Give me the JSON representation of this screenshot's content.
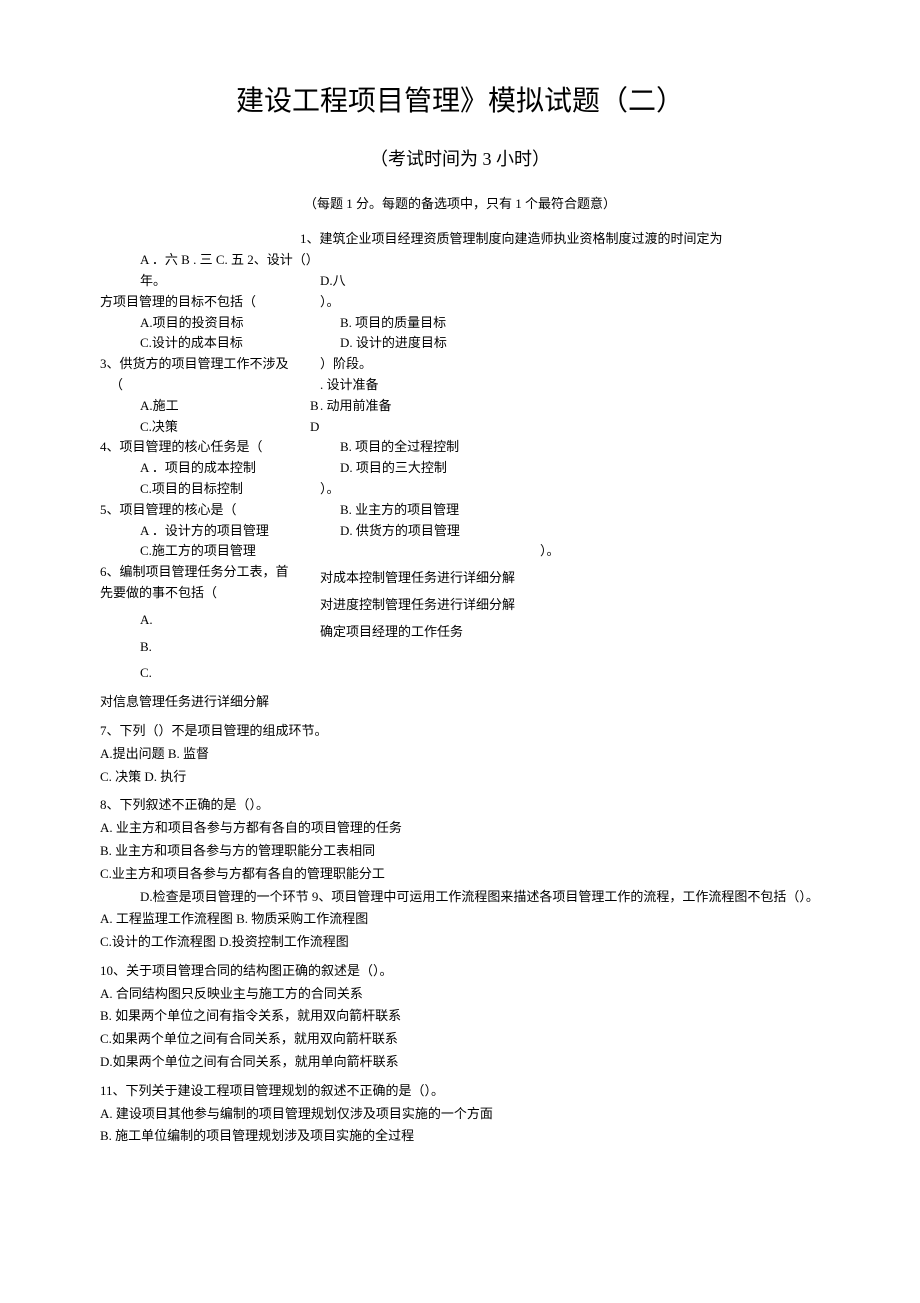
{
  "title": "建设工程项目管理》模拟试题（二）",
  "subtitle": "（考试时间为 3 小时）",
  "instruction": "（每题 1 分。每题的备选项中，只有 1 个最符合题意）",
  "q1_intro": "1、建筑企业项目经理资质管理制度向建造师执业资格制度过渡的时间定为",
  "q1_opts_left": "A ．六 B . 三 C. 五 2、设计（）年。",
  "q2_stem": "方项目管理的目标不包括（",
  "q1_d": "D.八",
  "q2_a": "A.项目的投资目标",
  "q2_paren": "）。",
  "q2_c": "C.设计的成本目标",
  "q2_b": "B. 项目的质量目标",
  "q3_stem": "3、供货方的项目管理工作不涉及",
  "q2_d": "D. 设计的进度目标",
  "q3_paren_open": "（",
  "q3_paren_close": "）阶段。",
  "q3_a": "A.施工",
  "q3_b_label": "B",
  "q3_b_text": ". 设计准备",
  "q3_c": "C.决策",
  "q3_d_label": "D",
  "q3_d_text": ". 动用前准备",
  "q4_stem": "4、项目管理的核心任务是（",
  "q4_a": "A ．项目的成本控制",
  "q4_b": "B. 项目的全过程控制",
  "q4_c": "C.项目的目标控制",
  "q4_d": "D. 项目的三大控制",
  "q5_stem": "5、项目管理的核心是（",
  "q5_paren": "）。",
  "q5_a": "A ．设计方的项目管理",
  "q5_b": "B. 业主方的项目管理",
  "q5_c": "C.施工方的项目管理",
  "q6_stem": "6、编制项目管理任务分工表，首",
  "q5_d": "D. 供货方的项目管理",
  "q6_stem2": "先要做的事不包括（",
  "q6_paren": "）。",
  "q6_a_label": "A.",
  "q6_a_text": "对成本控制管理任务进行详细分解",
  "q6_b_label": "B.",
  "q6_b_text": "对进度控制管理任务进行详细分解",
  "q6_c_label": "C.",
  "q6_c_text": "确定项目经理的工作任务",
  "q6_extra": "对信息管理任务进行详细分解",
  "q7_stem": "7、下列（）不是项目管理的组成环节。",
  "q7_ab": "A.提出问题 B. 监督",
  "q7_cd": "C. 决策 D. 执行",
  "q8_stem": "8、下列叙述不正确的是（）。",
  "q8_a": "A. 业主方和项目各参与方都有各自的项目管理的任务",
  "q8_b": "B. 业主方和项目各参与方的管理职能分工表相同",
  "q8_c": "C.业主方和项目各参与方都有各自的管理职能分工",
  "q8_d": "D.检查是项目管理的一个环节 9、项目管理中可运用工作流程图来描述各项目管理工作的流程，工作流程图不包括（）。",
  "q9_ab": "A. 工程监理工作流程图 B. 物质采购工作流程图",
  "q9_cd": "C.设计的工作流程图 D.投资控制工作流程图",
  "q10_stem": "10、关于项目管理合同的结构图正确的叙述是（）。",
  "q10_a": "A. 合同结构图只反映业主与施工方的合同关系",
  "q10_b": "B. 如果两个单位之间有指令关系，就用双向箭杆联系",
  "q10_c": "C.如果两个单位之间有合同关系，就用双向箭杆联系",
  "q10_d": "D.如果两个单位之间有合同关系，就用单向箭杆联系",
  "q11_stem": "11、下列关于建设工程项目管理规划的叙述不正确的是（）。",
  "q11_a": "A. 建设项目其他参与编制的项目管理规划仅涉及项目实施的一个方面",
  "q11_b": "B. 施工单位编制的项目管理规划涉及项目实施的全过程"
}
